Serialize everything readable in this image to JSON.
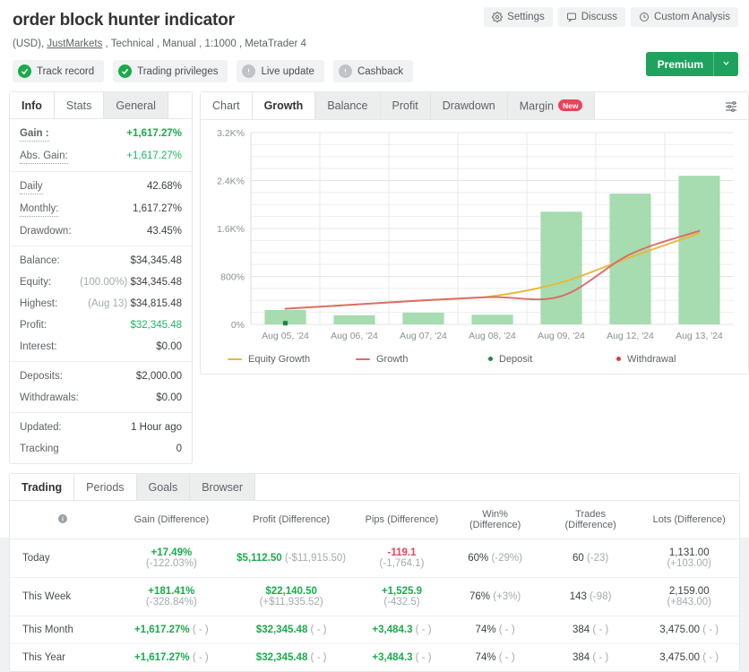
{
  "header": {
    "title": "order block hunter indicator",
    "subtitle_prefix": "(USD), ",
    "broker": "JustMarkets",
    "subtitle_rest": " , Technical , Manual , 1:1000 , MetaTrader 4",
    "buttons": [
      {
        "label": "Settings",
        "icon": "gear-icon"
      },
      {
        "label": "Discuss",
        "icon": "comment-icon"
      },
      {
        "label": "Custom Analysis",
        "icon": "clock-icon"
      }
    ],
    "badges": [
      {
        "label": "Track record",
        "state": "ok"
      },
      {
        "label": "Trading privileges",
        "state": "ok"
      },
      {
        "label": "Live update",
        "state": "off"
      },
      {
        "label": "Cashback",
        "state": "off"
      }
    ],
    "premium_label": "Premium",
    "premium_caret": "chevron-down-icon"
  },
  "sidebar": {
    "tabs": [
      {
        "label": "Info",
        "active": true
      },
      {
        "label": "Stats",
        "active": false,
        "plain": true
      },
      {
        "label": "General",
        "active": false
      }
    ],
    "groups": [
      {
        "rows": [
          {
            "key": "Gain :",
            "value": "+1,617.27%",
            "style": "green",
            "dotted": true,
            "key_bold": true
          },
          {
            "key": "Abs. Gain:",
            "value": "+1,617.27%",
            "style": "greenplain",
            "dotted": true
          }
        ]
      },
      {
        "rows": [
          {
            "key": "Daily",
            "value": "42.68%",
            "dotted": true
          },
          {
            "key": "Monthly:",
            "value": "1,617.27%",
            "dotted": true
          },
          {
            "key": "Drawdown:",
            "value": "43.45%"
          }
        ]
      },
      {
        "rows": [
          {
            "key": "Balance:",
            "value": "$34,345.48"
          },
          {
            "key": "Equity:",
            "value": "$34,345.48",
            "prefix": "(100.00%)"
          },
          {
            "key": "Highest:",
            "value": "$34,815.48",
            "prefix": "(Aug 13)"
          },
          {
            "key": "Profit:",
            "value": "$32,345.48",
            "style": "greenplain"
          },
          {
            "key": "Interest:",
            "value": "$0.00"
          }
        ]
      },
      {
        "rows": [
          {
            "key": "Deposits:",
            "value": "$2,000.00"
          },
          {
            "key": "Withdrawals:",
            "value": "$0.00"
          }
        ]
      },
      {
        "rows": [
          {
            "key": "Updated:",
            "value": "1 Hour ago"
          },
          {
            "key": "Tracking",
            "value": "0"
          }
        ]
      }
    ]
  },
  "chart_panel": {
    "tabs": [
      {
        "label": "Chart",
        "active": false,
        "plain": true
      },
      {
        "label": "Growth",
        "active": true
      },
      {
        "label": "Balance",
        "active": false
      },
      {
        "label": "Profit",
        "active": false
      },
      {
        "label": "Drawdown",
        "active": false
      },
      {
        "label": "Margin",
        "active": false,
        "badge": "New"
      }
    ],
    "settings_icon": "sliders-icon"
  },
  "chart_data": {
    "type": "bar",
    "title": "",
    "xlabel": "",
    "ylabel": "",
    "categories": [
      "Aug 05, '24",
      "Aug 06, '24",
      "Aug 07, '24",
      "Aug 08, '24",
      "Aug 09, '24",
      "Aug 12, '24",
      "Aug 13, '24"
    ],
    "ytick_labels": [
      "0%",
      "800%",
      "1.6K%",
      "2.4K%",
      "3.2K%"
    ],
    "ytick_values": [
      0,
      800,
      1600,
      2400,
      3200
    ],
    "ylim": [
      0,
      3200
    ],
    "grid": true,
    "legend_position": "bottom",
    "series": [
      {
        "name": "Bars",
        "type": "bar",
        "color": "#a6dcaf",
        "values": [
          240,
          150,
          195,
          160,
          1880,
          2180,
          2480
        ]
      },
      {
        "name": "Equity Growth",
        "type": "line",
        "color": "#e8b83a",
        "values": [
          260,
          330,
          400,
          470,
          700,
          1120,
          1520
        ]
      },
      {
        "name": "Growth",
        "type": "line",
        "color": "#dd6b66",
        "values": [
          260,
          330,
          400,
          455,
          470,
          1170,
          1560
        ]
      }
    ],
    "markers": [
      {
        "name": "Deposit",
        "color": "#1b8b3a",
        "x": "Aug 05, '24",
        "y": 20
      }
    ],
    "legend": [
      {
        "label": "Equity Growth",
        "color": "#e8b83a",
        "shape": "line"
      },
      {
        "label": "Growth",
        "color": "#dd6b66",
        "shape": "line"
      },
      {
        "label": "Deposit",
        "color": "#1b8b3a",
        "shape": "dot"
      },
      {
        "label": "Withdrawal",
        "color": "#e03c3c",
        "shape": "dot"
      }
    ]
  },
  "bottom": {
    "tabs": [
      {
        "label": "Trading",
        "active": true
      },
      {
        "label": "Periods",
        "active": false,
        "plain": true
      },
      {
        "label": "Goals",
        "active": false
      },
      {
        "label": "Browser",
        "active": false
      }
    ],
    "columns": [
      "",
      "Gain (Difference)",
      "Profit (Difference)",
      "Pips (Difference)",
      "Win% (Difference)",
      "Trades (Difference)",
      "Lots (Difference)"
    ],
    "info_icon": "info-icon",
    "rows": [
      {
        "period": "Today",
        "cells": [
          {
            "main": "+17.49%",
            "diff": "(-122.03%)",
            "style": "pos"
          },
          {
            "main": "$5,112.50",
            "diff": "(-$11,915.50)",
            "style": "pos"
          },
          {
            "main": "-119.1",
            "diff": "(-1,764.1)",
            "style": "neg"
          },
          {
            "main": "60%",
            "diff": "(-29%)",
            "style": "plain"
          },
          {
            "main": "60",
            "diff": "(-23)",
            "style": "plain"
          },
          {
            "main": "1,131.00",
            "diff": "(+103.00)",
            "style": "plain"
          }
        ]
      },
      {
        "period": "This Week",
        "cells": [
          {
            "main": "+181.41%",
            "diff": "(-328.84%)",
            "style": "pos"
          },
          {
            "main": "$22,140.50",
            "diff": "(+$11,935.52)",
            "style": "pos"
          },
          {
            "main": "+1,525.9",
            "diff": "(-432.5)",
            "style": "pos"
          },
          {
            "main": "76%",
            "diff": "(+3%)",
            "style": "plain"
          },
          {
            "main": "143",
            "diff": "(-98)",
            "style": "plain"
          },
          {
            "main": "2,159.00",
            "diff": "(+843.00)",
            "style": "plain"
          }
        ]
      },
      {
        "period": "This Month",
        "cells": [
          {
            "main": "+1,617.27%",
            "diff": "( - )",
            "style": "pos"
          },
          {
            "main": "$32,345.48",
            "diff": "( - )",
            "style": "pos"
          },
          {
            "main": "+3,484.3",
            "diff": "( - )",
            "style": "pos"
          },
          {
            "main": "74%",
            "diff": "( - )",
            "style": "plain"
          },
          {
            "main": "384",
            "diff": "( - )",
            "style": "plain"
          },
          {
            "main": "3,475.00",
            "diff": "( - )",
            "style": "plain"
          }
        ]
      },
      {
        "period": "This Year",
        "cells": [
          {
            "main": "+1,617.27%",
            "diff": "( - )",
            "style": "pos"
          },
          {
            "main": "$32,345.48",
            "diff": "( - )",
            "style": "pos"
          },
          {
            "main": "+3,484.3",
            "diff": "( - )",
            "style": "pos"
          },
          {
            "main": "74%",
            "diff": "( - )",
            "style": "plain"
          },
          {
            "main": "384",
            "diff": "( - )",
            "style": "plain"
          },
          {
            "main": "3,475.00",
            "diff": "( - )",
            "style": "plain"
          }
        ]
      }
    ]
  }
}
